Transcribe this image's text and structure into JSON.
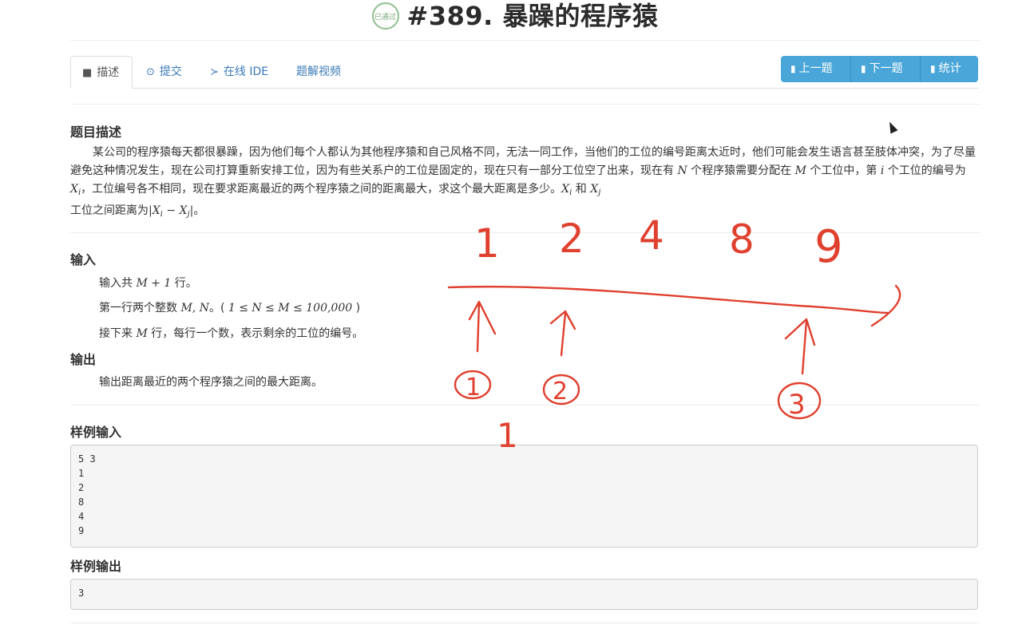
{
  "header": {
    "title": "#389. 暴躁的程序猿",
    "badge_text": "已通过"
  },
  "tabs": [
    {
      "icon": "book-icon",
      "label": "描述"
    },
    {
      "icon": "upload-icon",
      "label": "提交"
    },
    {
      "icon": "terminal-icon",
      "label": "在线 IDE"
    },
    {
      "icon": "",
      "label": "题解视频"
    }
  ],
  "nav_buttons": {
    "prev": "上一题",
    "next": "下一题",
    "stats": "统计"
  },
  "description": {
    "heading": "题目描述",
    "text_1": "某公司的程序猿每天都很暴躁，因为他们每个人都认为其他程序猿和自己风格不同，无法一同工作，当他们的工位的编号距离太近时，他们可能会发生语言甚至肢体冲突，为了尽量避免这种情况发生，现在公司打算重新安排工位，因为有些关系户的工位是固定的，现在只有一部分工位空了出来，现在有",
    "var_N": "N",
    "text_2": "个程序猿需要分配在",
    "var_M": "M",
    "text_3": "个工位中，第",
    "var_i": "i",
    "text_4": "个工位的编号为",
    "var_X": "X",
    "sub_i": "i",
    "sub_j": "j",
    "text_5": "，工位编号各不相同，现在要求距离最近的两个程序猿之间的距离最大，求这个最大距离是多少。",
    "text_6": "和",
    "text_7": "工位之间距离为",
    "abs_expr_open": "|",
    "minus": "−",
    "abs_expr_close": "|",
    "text_8": "。"
  },
  "input": {
    "heading": "输入",
    "line1_a": "输入共",
    "line1_math": "M + 1",
    "line1_b": "行。",
    "line2_a": "第一行两个整数",
    "line2_math": "M, N",
    "line2_b": "。(",
    "line2_constraint": "1 ≤ N ≤ M ≤ 100,000",
    "line2_c": ")",
    "line3_a": "接下来",
    "line3_math": "M",
    "line3_b": "行，每行一个数，表示剩余的工位的编号。"
  },
  "output": {
    "heading": "输出",
    "text": "输出距离最近的两个程序猿之间的最大距离。"
  },
  "sample_input": {
    "heading": "样例输入",
    "lines": [
      "5 3",
      "1",
      "2",
      "8",
      "4",
      "9"
    ]
  },
  "sample_output": {
    "heading": "样例输出",
    "lines": [
      "3"
    ]
  },
  "annotations": {
    "numbers": [
      "1",
      "2",
      "4",
      "8",
      "9"
    ],
    "circled": [
      "1",
      "2",
      "3"
    ],
    "below": "1",
    "color": "#e0402e"
  }
}
